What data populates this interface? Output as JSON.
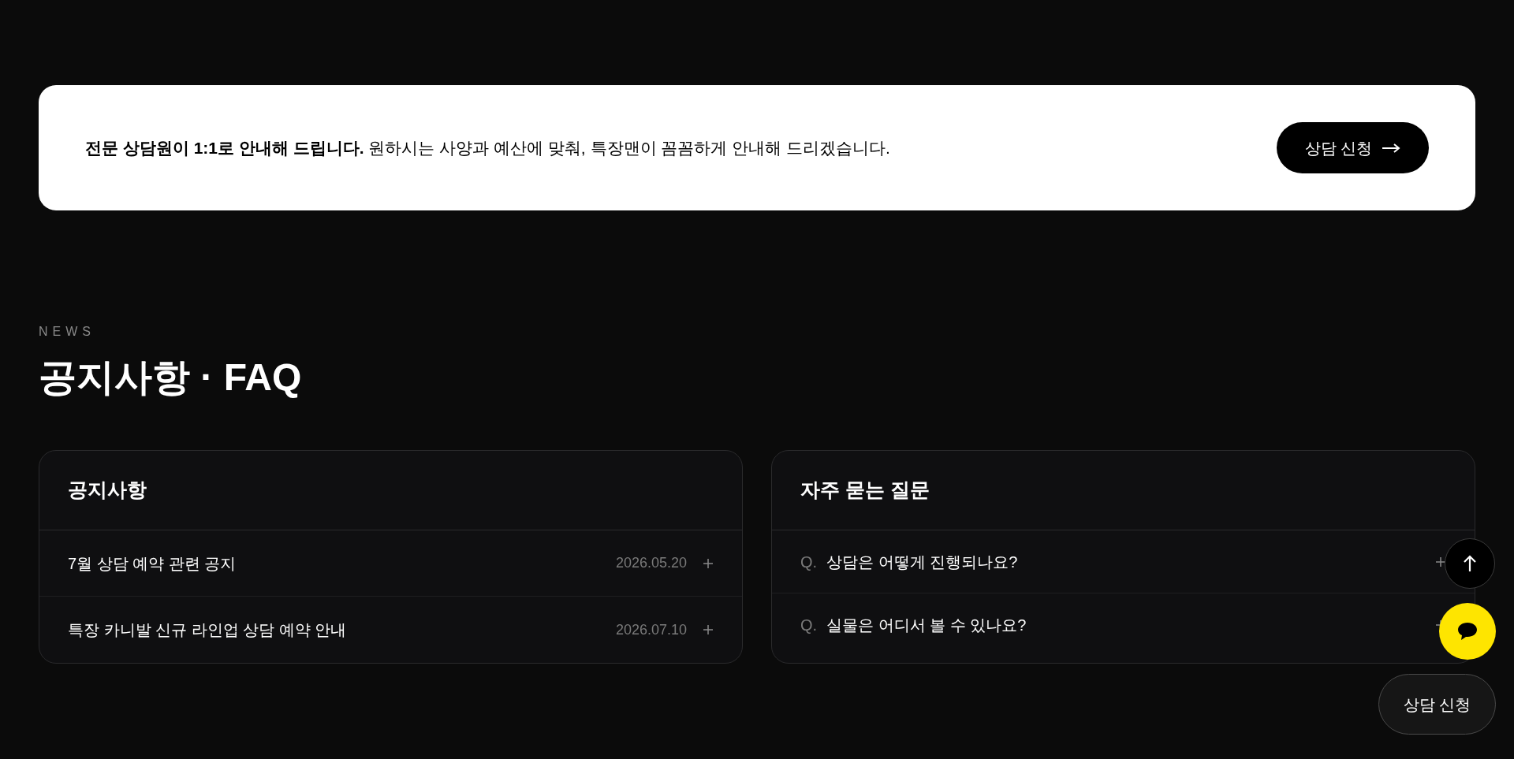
{
  "banner": {
    "text": "**전문 상담원이 1:1로 안내해 드립니다.** 원하시는 사양과 예산에 맞춰, 특장맨이 꼼꼼하게 안내해 드리겠습니다.",
    "button": "상담 신청"
  },
  "section": {
    "eyebrow": "NEWS",
    "title": "공지사항 · FAQ"
  },
  "notices": {
    "title": "공지사항",
    "items": [
      {
        "title": "7월 상담 예약 관련 공지",
        "date": "2026.05.20"
      },
      {
        "title": "특장 카니발 신규 라인업 상담 예약 안내",
        "date": "2026.07.10"
      }
    ]
  },
  "faq": {
    "title": "자주 묻는 질문",
    "items": [
      {
        "prefix": "Q.",
        "question": "상담은 어떻게 진행되나요?"
      },
      {
        "prefix": "Q.",
        "question": "실물은 어디서 볼 수 있나요?"
      }
    ]
  },
  "floating": {
    "consult_button": "상담 신청"
  }
}
